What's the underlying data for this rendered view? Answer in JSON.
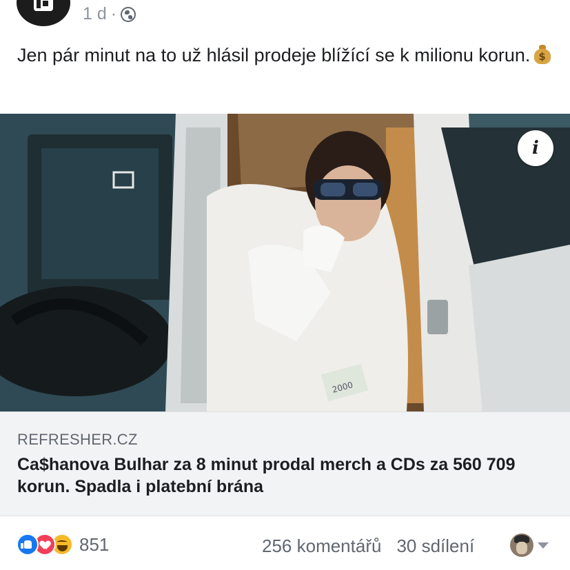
{
  "post": {
    "time": "1 d",
    "separator": "·",
    "audience_icon": "globe-icon",
    "text": "Jen pár minut na to už hlásil prodeje blížící se k milionu korun.",
    "emoji": "money-bag"
  },
  "link": {
    "image_alt": "Man in white suit and sunglasses smoking in a car",
    "info_label": "i",
    "domain": "REFRESHER.CZ",
    "title": "Ca$hanova Bulhar za 8 minut prodal merch a CDs za 560 709 korun. Spadla i platební brána"
  },
  "footer": {
    "reactions": [
      "like",
      "love",
      "haha"
    ],
    "reaction_count": "851",
    "comments": "256 komentářů",
    "shares": "30 sdílení"
  },
  "colors": {
    "facebook_blue": "#1877f2",
    "love_red": "#f33e58",
    "haha_yellow": "#f7b928",
    "muted_text": "#606770",
    "card_bg": "#f2f3f5"
  }
}
